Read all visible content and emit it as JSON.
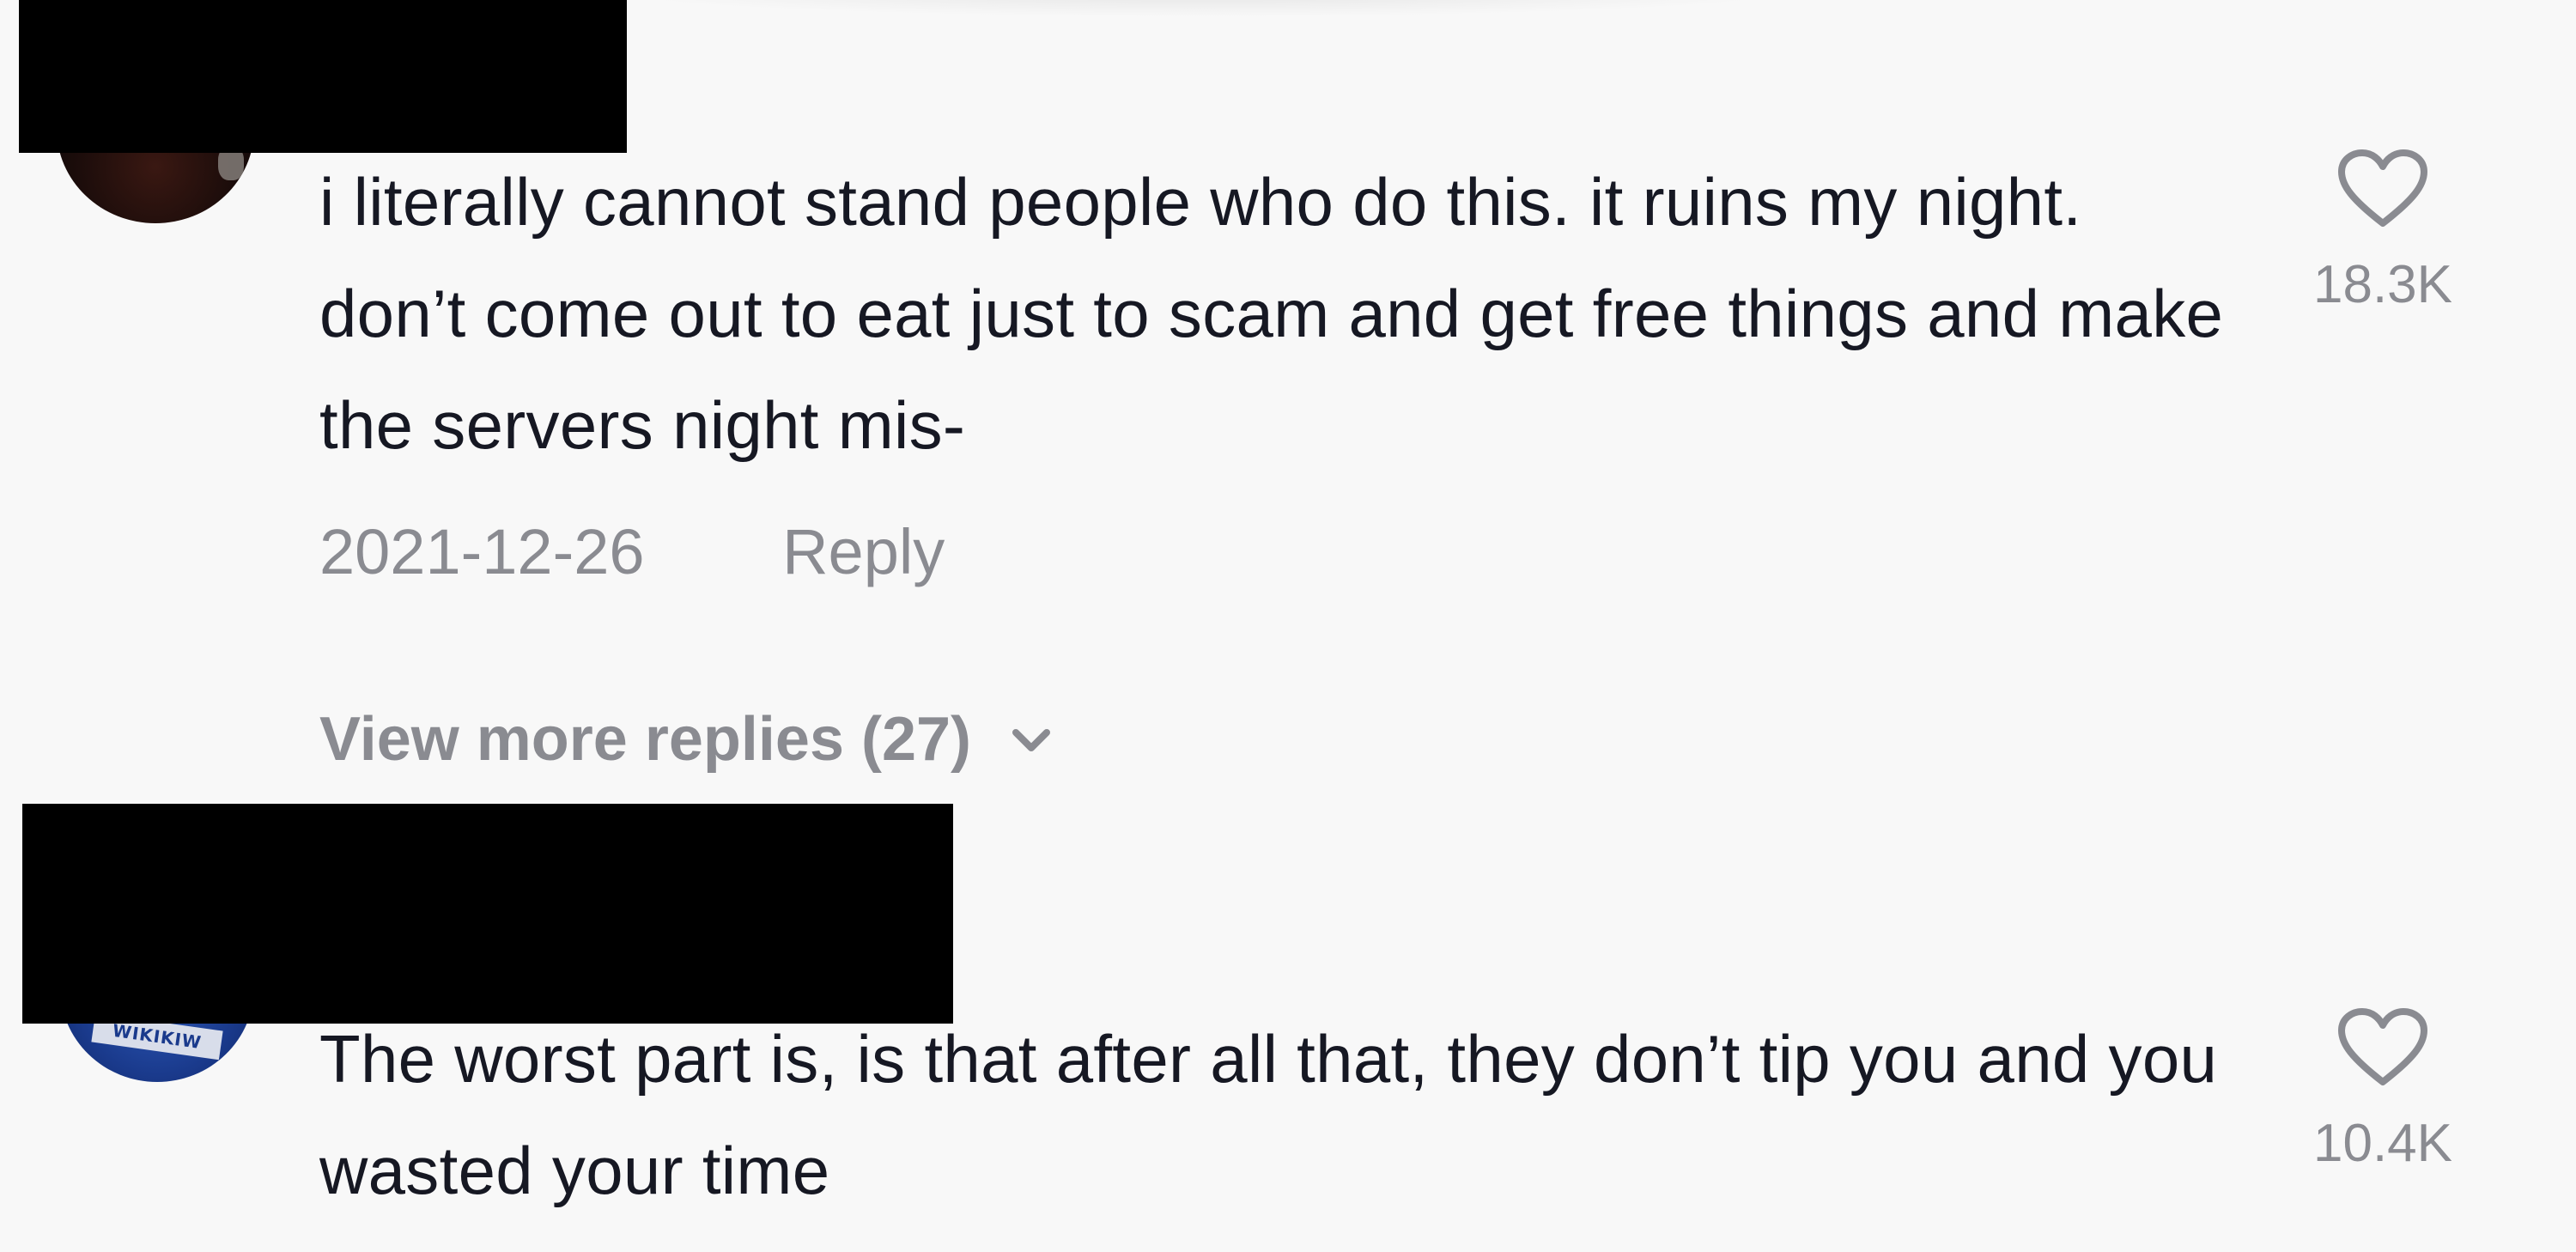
{
  "comments": [
    {
      "text": "i literally cannot stand people who do this. it ruins my night. don’t come out to eat just to scam and get free things and make the servers night mis-",
      "date": "2021-12-26",
      "reply_label": "Reply",
      "likes": "18.3K",
      "view_more_replies": "View more replies (27)"
    },
    {
      "text": "The worst part is, is that after all that, they don’t tip you and you wasted your time",
      "likes": "10.4K",
      "avatar_badge_text": "WIKIKIW"
    }
  ],
  "icons": {
    "like": "heart-outline-icon",
    "expand": "chevron-down-icon"
  },
  "colors": {
    "background": "#f8f8f8",
    "text_primary": "#161823",
    "text_secondary": "#8a8b91",
    "redaction": "#000000"
  }
}
